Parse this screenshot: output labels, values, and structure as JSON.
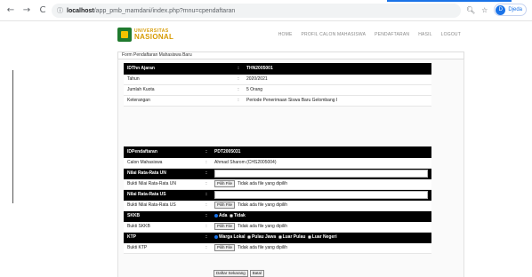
{
  "browser": {
    "url_host": "localhost",
    "url_path": "/app_pmb_mamdani/index.php?mnu=cpendaftaran",
    "profile_initial": "D",
    "profile_name": "Djeda"
  },
  "header": {
    "logo_top": "UNIVERSITAS",
    "logo_main": "NASIONAL",
    "nav": [
      "HOME",
      "PROFIL CALON MAHASISWA",
      "PENDAFTARAN",
      "HASIL",
      "LOGOUT"
    ]
  },
  "form_title": "Form Pendaftaran Mahasiswa Baru",
  "tahun_ajaran": {
    "header_label": "IDThn Ajaran",
    "header_value": "THN2005001",
    "rows": [
      {
        "label": "Tahun",
        "value": "2020/2021"
      },
      {
        "label": "Jumlah Kuota",
        "value": "5 Orang"
      },
      {
        "label": "Keterangan",
        "value": "Periode Penerimaan Siswa Baru Gelombang I"
      }
    ]
  },
  "pendaftaran": {
    "id_label": "IDPendaftaran",
    "id_value": "PDT2005031",
    "calon_label": "Calon Mahasiswa",
    "calon_value": "Ahmad Sharom (CHS2005004)",
    "un_label": "Nilai Rata-Rata UN",
    "bukti_un_label": "Bukti Nilai Rata-Rata UN",
    "us_label": "Nilai Rata-Rata US",
    "bukti_us_label": "Bukti Nilai Rata-Rata US",
    "skkb_label": "SKKB",
    "skkb_options": [
      "Ada",
      "Tidak"
    ],
    "bukti_skkb_label": "Bukti SKKB",
    "ktp_label": "KTP",
    "ktp_options": [
      "Warga Lokal",
      "Pulau Jawa",
      "Luar Pulau",
      "Luar Negeri"
    ],
    "bukti_ktp_label": "Bukti KTP",
    "file_button": "Pilih File",
    "file_none": "Tidak ada file yang dipilih",
    "separator": ":"
  },
  "buttons": {
    "submit": "Daftar Sekarang",
    "cancel": "Batal"
  }
}
